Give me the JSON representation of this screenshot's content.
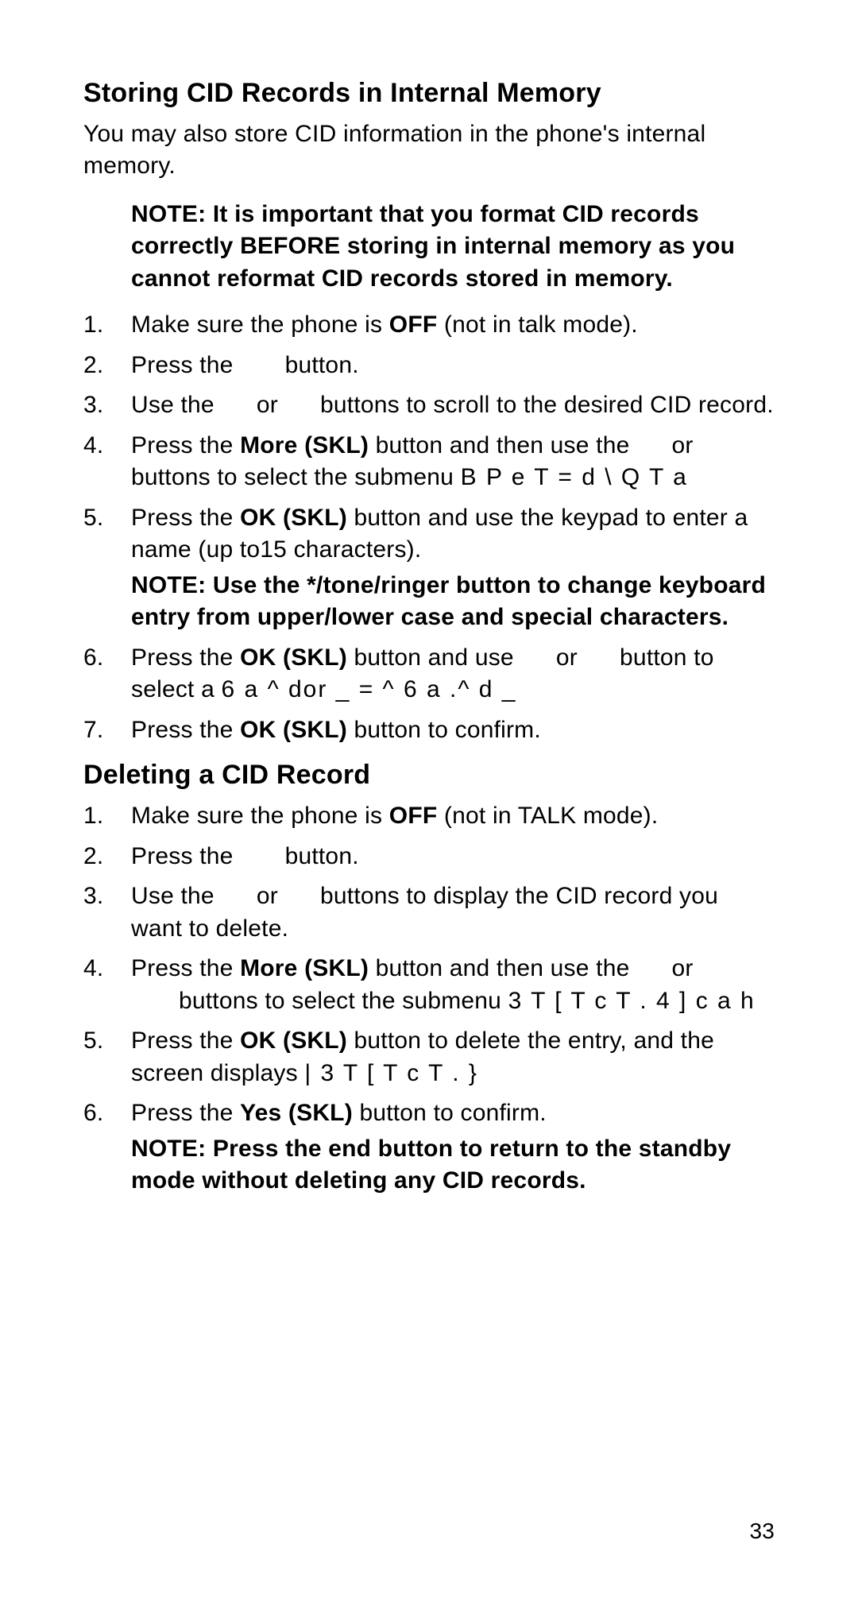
{
  "page_number": "33",
  "section1": {
    "heading": "Storing CID Records in Internal Memory",
    "intro": "You may also store CID information in the phone's internal memory.",
    "note": "NOTE: It is important that you format CID records correctly BEFORE storing in internal memory as you cannot reformat CID records stored in memory.",
    "steps": [
      {
        "pre": "Make sure the phone is ",
        "bold": "OFF",
        "post": " (not in talk mode)."
      },
      {
        "pre": "Press the ",
        "gap": true,
        "post": " button."
      },
      {
        "pre": "Use the ",
        "mid": " or ",
        "post": " buttons to scroll to the desired CID record."
      },
      {
        "pre": "Press the ",
        "bold": "More (SKL)",
        "post": " button and then use the ",
        "mid": " or ",
        "tail": " buttons to select the submenu  ",
        "mono": "B P e T   = d \\ Q T a"
      },
      {
        "pre": "Press the ",
        "bold": "OK (SKL)",
        "post": " button and use the keypad to enter a name (up to15 characters).",
        "subnote": "NOTE: Use the */tone/ringer button to change keyboard entry from upper/lower case and special characters."
      },
      {
        "pre": "Press the ",
        "bold": "OK (SKL)",
        "post": " button and use ",
        "mid": " or ",
        "tail": " button to select a  ",
        "mono": "6 a ^ dor _ = ^   6 a .^ d _"
      },
      {
        "pre": "Press the ",
        "bold": "OK (SKL)",
        "post": " button to confirm."
      }
    ]
  },
  "section2": {
    "heading": "Deleting a CID Record",
    "steps": [
      {
        "pre": "Make sure the phone is ",
        "bold": "OFF",
        "post": " (not in TALK mode)."
      },
      {
        "pre": "Press the ",
        "gap": true,
        "post": " button."
      },
      {
        "pre": "Use the ",
        "mid": " or ",
        "post": " buttons to display the CID record you want to delete."
      },
      {
        "pre": "Press the ",
        "bold": "More (SKL)",
        "post": " button and then use the ",
        "mid": " or ",
        "tail_indent": " buttons to select the submenu  ",
        "mono": "3 T [ T c T .  4 ] c a h"
      },
      {
        "pre": "Press the ",
        "bold": "OK (SKL)",
        "post": " button to delete the entry, and the screen displays  ",
        "mono": "| 3 T [ T c T . }"
      },
      {
        "pre": "Press the ",
        "bold": "Yes (SKL)",
        "post": " button to confirm.",
        "subnote": "NOTE: Press the end button to return to the standby mode without deleting any CID records."
      }
    ]
  }
}
